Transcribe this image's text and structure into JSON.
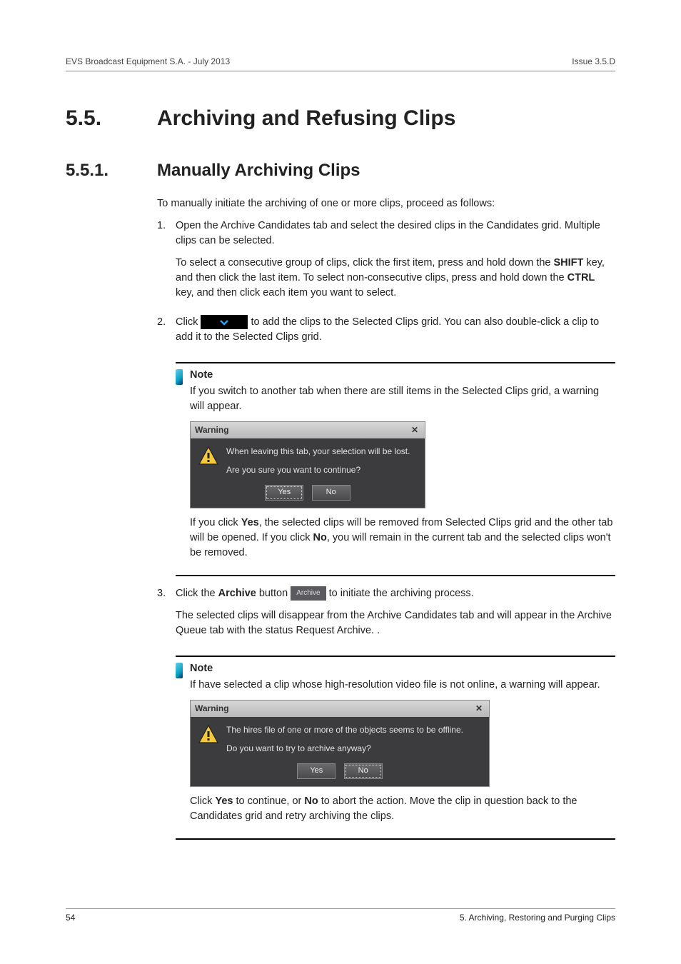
{
  "header": {
    "left": "EVS Broadcast Equipment S.A. - July 2013",
    "right": "Issue 3.5.D"
  },
  "h1": {
    "num": "5.5.",
    "text": "Archiving and Refusing Clips"
  },
  "h2": {
    "num": "5.5.1.",
    "text": "Manually Archiving Clips"
  },
  "intro": "To manually initiate the archiving of one or more clips, proceed as follows:",
  "step1": {
    "num": "1.",
    "p1": "Open the Archive Candidates tab and select the desired clips in the Candidates grid. Multiple clips can be selected.",
    "p2a": "To select a consecutive group of clips, click the first item, press and hold down the ",
    "shift": "SHIFT",
    "p2b": " key, and then click the last item. To select non-consecutive clips, press and hold down the ",
    "ctrl": "CTRL",
    "p2c": " key, and then click each item you want to select."
  },
  "step2": {
    "num": "2.",
    "pa": "Click ",
    "pb": " to add the clips to the Selected Clips grid. You can also double-click a clip to add it to the Selected Clips grid."
  },
  "note1": {
    "title": "Note",
    "p": "If you switch to another tab when there are still items in the Selected Clips grid, a warning will appear.",
    "dlg": {
      "title": "Warning",
      "line1": "When leaving this tab, your selection will be lost.",
      "line2": "Are you sure you want to continue?",
      "yes": "Yes",
      "no": "No"
    },
    "after_a": "If you click ",
    "yes": "Yes",
    "after_b": ", the selected clips will be removed from Selected Clips grid and the other tab will be opened. If you click ",
    "no": "No",
    "after_c": ", you will remain in the current tab and the selected clips won't be removed."
  },
  "step3": {
    "num": "3.",
    "pa": "Click the ",
    "archive": "Archive",
    "pb": " button ",
    "btn_label": "Archive",
    "pc": " to initiate the archiving process.",
    "p2": "The selected clips will disappear from the Archive Candidates tab and will appear in the Archive Queue tab with the status Request Archive. ."
  },
  "note2": {
    "title": "Note",
    "p": "If have selected a clip whose high-resolution video file is not online, a warning will appear.",
    "dlg": {
      "title": "Warning",
      "line1": "The hires file of one or more of the objects seems to be offline.",
      "line2": "Do you want to try to archive anyway?",
      "yes": "Yes",
      "no": "No"
    },
    "after_a": "Click ",
    "yes": "Yes",
    "after_b": " to continue, or ",
    "no": "No",
    "after_c": " to abort the action. Move the clip in question back to the Candidates grid and retry archiving the clips."
  },
  "footer": {
    "left": "54",
    "right": "5. Archiving, Restoring and Purging Clips"
  }
}
